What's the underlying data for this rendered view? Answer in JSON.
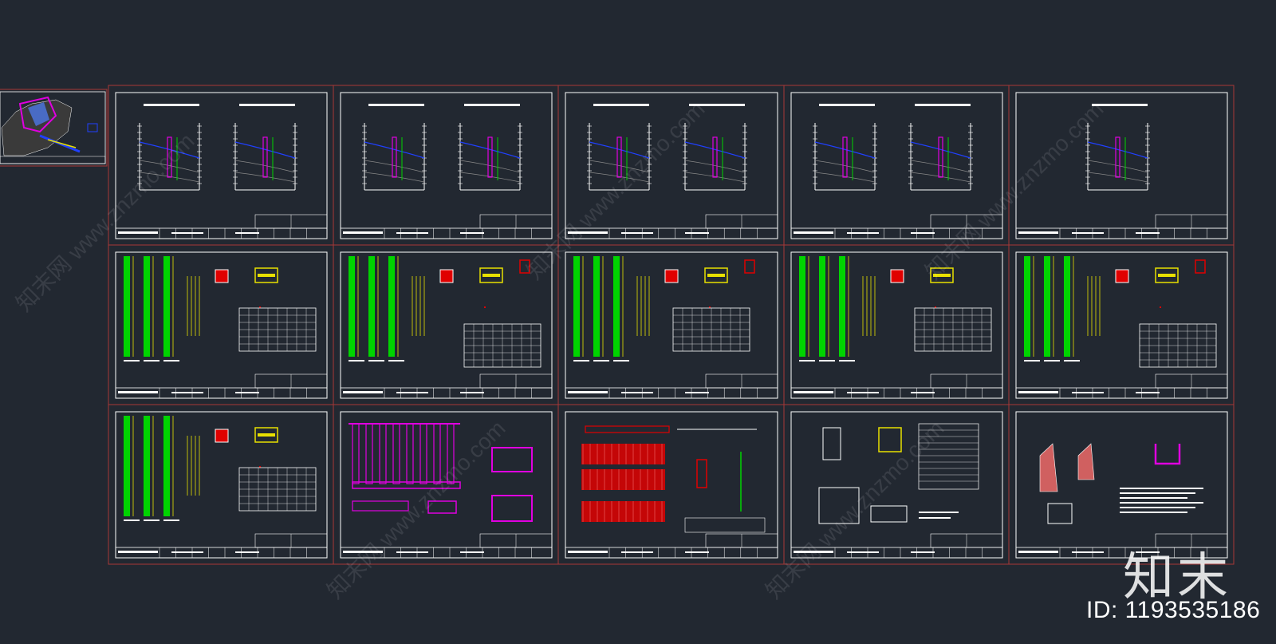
{
  "colors": {
    "background": "#222831",
    "sheet_border": "#a83838",
    "linework": "#ffffff",
    "steel_green": "#00d400",
    "rebar_yellow": "#e8e000",
    "section_red": "#e00000",
    "magenta": "#e000e0",
    "blue": "#2040ff"
  },
  "watermark": {
    "logo_text": "知末",
    "id_text": "ID: 1193535186",
    "diagonal_text": "知末网 www.znzmo.com"
  },
  "sheets": {
    "rows": 3,
    "cols": 5,
    "types": [
      "section",
      "section",
      "section",
      "section",
      "section-single",
      "pile-detail",
      "pile-detail",
      "pile-detail",
      "pile-detail",
      "pile-detail",
      "pile-detail",
      "pile-layout",
      "beam-rebar",
      "joint-detail",
      "masonry-detail"
    ]
  }
}
